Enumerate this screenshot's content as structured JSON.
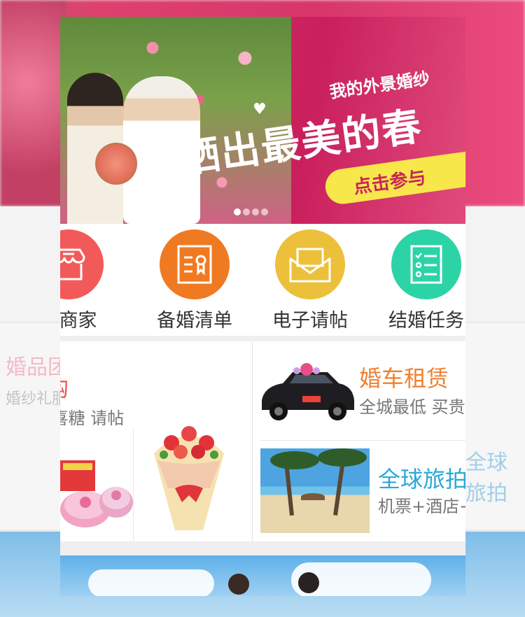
{
  "banner": {
    "line1": "我的外景婚纱",
    "line2": "晒出最美的春",
    "cta": "点击参与",
    "slides": 4,
    "active_slide": 1
  },
  "categories": [
    {
      "label": "找商家",
      "color": "#f25a5a",
      "icon": "shop-icon"
    },
    {
      "label": "备婚清单",
      "color": "#f07a22",
      "icon": "certificate-icon"
    },
    {
      "label": "电子请帖",
      "color": "#ecc03a",
      "icon": "envelope-icon"
    },
    {
      "label": "结婚任务",
      "color": "#2cd3a6",
      "icon": "checklist-icon"
    }
  ],
  "promos": {
    "shop": {
      "title": "婚品团购",
      "subtitle": "婚纱礼服 喜糖 请帖"
    },
    "car": {
      "title": "婚车租赁",
      "subtitle": "全城最低 买贵退钱"
    },
    "travel": {
      "title": "全球旅拍",
      "subtitle": "机票+酒店+拍摄"
    }
  },
  "colors": {
    "accent_red": "#ee5555",
    "accent_orange": "#f08030",
    "accent_blue": "#2aa8d8"
  }
}
